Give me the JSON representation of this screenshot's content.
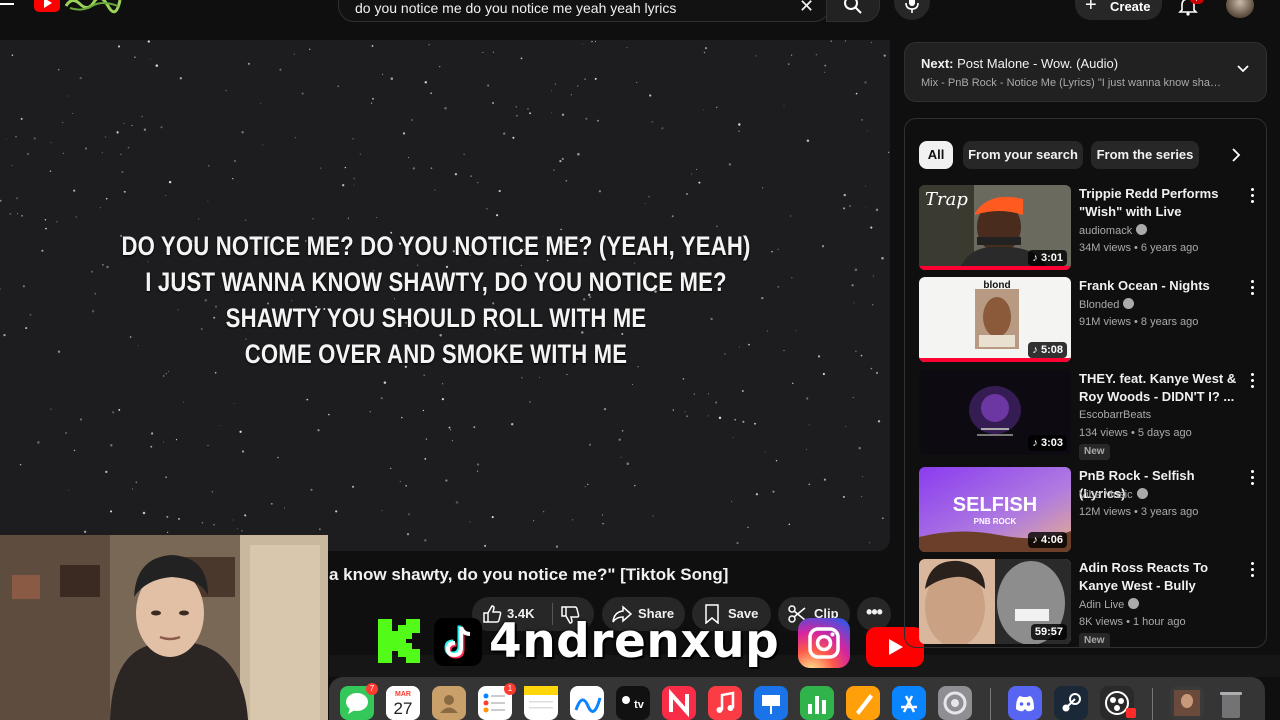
{
  "search": {
    "query": "do you notice me do you notice me yeah yeah lyrics"
  },
  "header": {
    "create_label": "Create",
    "notification_count": "7"
  },
  "video": {
    "lyrics": [
      "DO YOU NOTICE ME? DO YOU NOTICE ME? (YEAH, YEAH)",
      "I JUST WANNA KNOW SHAWTY, DO YOU NOTICE ME?",
      "SHAWTY YOU SHOULD ROLL WITH ME",
      "COME OVER AND SMOKE WITH ME"
    ],
    "title": "a know shawty, do you notice me?\" [Tiktok Song]"
  },
  "actions": {
    "likes": "3.4K",
    "share": "Share",
    "save": "Save",
    "clip": "Clip",
    "more": "•••"
  },
  "overlay": {
    "handle": "4ndrenxup"
  },
  "up_next": {
    "label": "Next:",
    "title": "Post Malone - Wow. (Audio)",
    "subtitle": "Mix - PnB Rock - Notice Me (Lyrics) \"I just wanna know shawty, do you notice me?\""
  },
  "chips": [
    "All",
    "From your search",
    "From the series"
  ],
  "recommendations": [
    {
      "title": "Trippie Redd Performs \"Wish\" with Live Orchestra...",
      "channel": "audiomack",
      "meta": "34M views • 6 years ago",
      "duration": "3:01",
      "verified": true
    },
    {
      "title": "Frank Ocean - Nights",
      "channel": "Blonded",
      "meta": "91M views • 8 years ago",
      "duration": "5:08",
      "verified": true
    },
    {
      "title": "THEY. feat. Kanye West & Roy Woods - DIDN'T I? ...",
      "channel": "EscobarrBeats",
      "meta": "134 views • 5 days ago",
      "duration": "3:03",
      "badge": "New",
      "verified": false
    },
    {
      "title": "PnB Rock - Selfish (Lyrics)",
      "channel": "Vibe Music",
      "meta": "12M views • 3 years ago",
      "duration": "4:06",
      "verified": true
    },
    {
      "title": "Adin Ross Reacts To Kanye West - Bully",
      "channel": "Adin Live",
      "meta": "8K views • 1 hour ago",
      "duration": "59:57",
      "badge": "New",
      "verified": true
    }
  ],
  "thumb_text": {
    "trap": "Trap",
    "blond": "blond",
    "selfish": "SELFISH",
    "selfish_sub": "PNB ROCK"
  },
  "dock": {
    "messages_badge": "7",
    "calendar_month": "MAR",
    "calendar_day": "27",
    "reminders_badge": "1",
    "tv_label": "tv"
  },
  "colors": {
    "accent_red": "#ff0033",
    "background": "#0f0f0f",
    "chip_bg": "#272727"
  }
}
